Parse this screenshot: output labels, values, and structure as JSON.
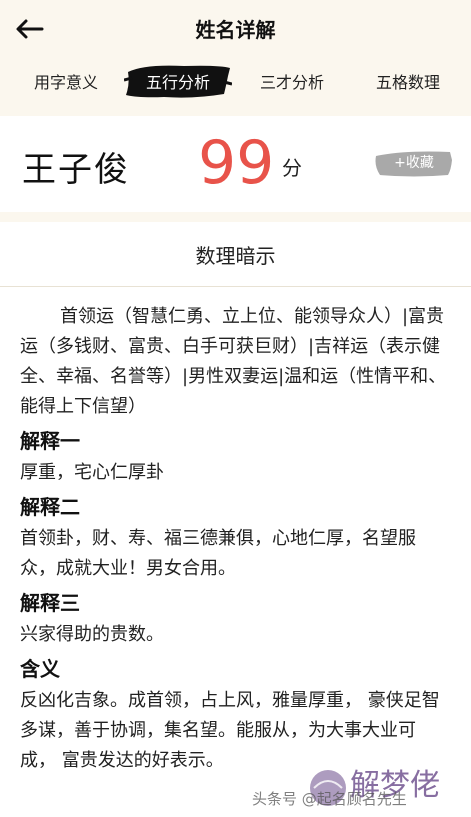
{
  "header": {
    "title": "姓名详解",
    "back_icon": "arrow-left-icon"
  },
  "tabs": [
    {
      "label": "用字意义",
      "active": false
    },
    {
      "label": "五行分析",
      "active": true
    },
    {
      "label": "三才分析",
      "active": false
    },
    {
      "label": "五格数理",
      "active": false
    }
  ],
  "score_card": {
    "name": "王子俊",
    "score": "99",
    "unit": "分",
    "collect_label": "+收藏"
  },
  "content": {
    "section_title": "数理暗示",
    "intro": "首领运（智慧仁勇、立上位、能领导众人）|富贵运（多钱财、富贵、白手可获巨财）|吉祥运（表示健全、幸福、名誉等）|男性双妻运|温和运（性情平和、能得上下信望）",
    "blocks": [
      {
        "heading": "解释一",
        "text": "厚重，宅心仁厚卦"
      },
      {
        "heading": "解释二",
        "text": "首领卦，财、寿、福三德兼俱，心地仁厚，名望服众，成就大业！男女合用。"
      },
      {
        "heading": "解释三",
        "text": "兴家得助的贵数。"
      },
      {
        "heading": "含义",
        "text": "反凶化吉象。成首领，占上风，雅量厚重， 豪侠足智多谋，善于协调，集名望。能服从，为大事大业可成， 富贵发达的好表示。"
      }
    ]
  },
  "watermark": {
    "text": "头条号 @起名顾名先生",
    "logo_text": "解梦佬"
  },
  "colors": {
    "background": "#fbf7ee",
    "score": "#e8534a",
    "active_tab_brush": "#111111"
  }
}
